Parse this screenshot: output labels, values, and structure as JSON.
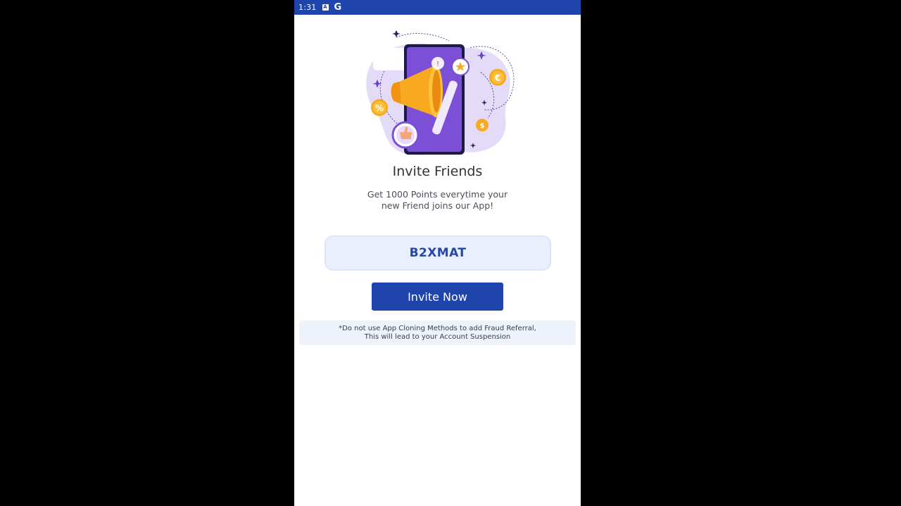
{
  "status_bar": {
    "time": "1:31",
    "icons": [
      "notification-a-icon",
      "google-g-icon"
    ],
    "g_letter": "G",
    "a_letter": "A"
  },
  "colors": {
    "primary": "#1f45ad",
    "code_bg": "#e9effc",
    "warning_bg": "#edf2fb",
    "accent_orange": "#f6a21b",
    "accent_purple": "#6b3fc8"
  },
  "illustration": {
    "icon": "megaphone-phone-illustration"
  },
  "invite": {
    "title": "Invite Friends",
    "subtitle_line1": "Get 1000 Points everytime your",
    "subtitle_line2": "new Friend joins our App!",
    "referral_code": "B2XMAT",
    "button_label": "Invite Now"
  },
  "warning": {
    "line1": "*Do not use App Cloning Methods to add Fraud Referral,",
    "line2": "This will lead to your Account Suspension"
  }
}
